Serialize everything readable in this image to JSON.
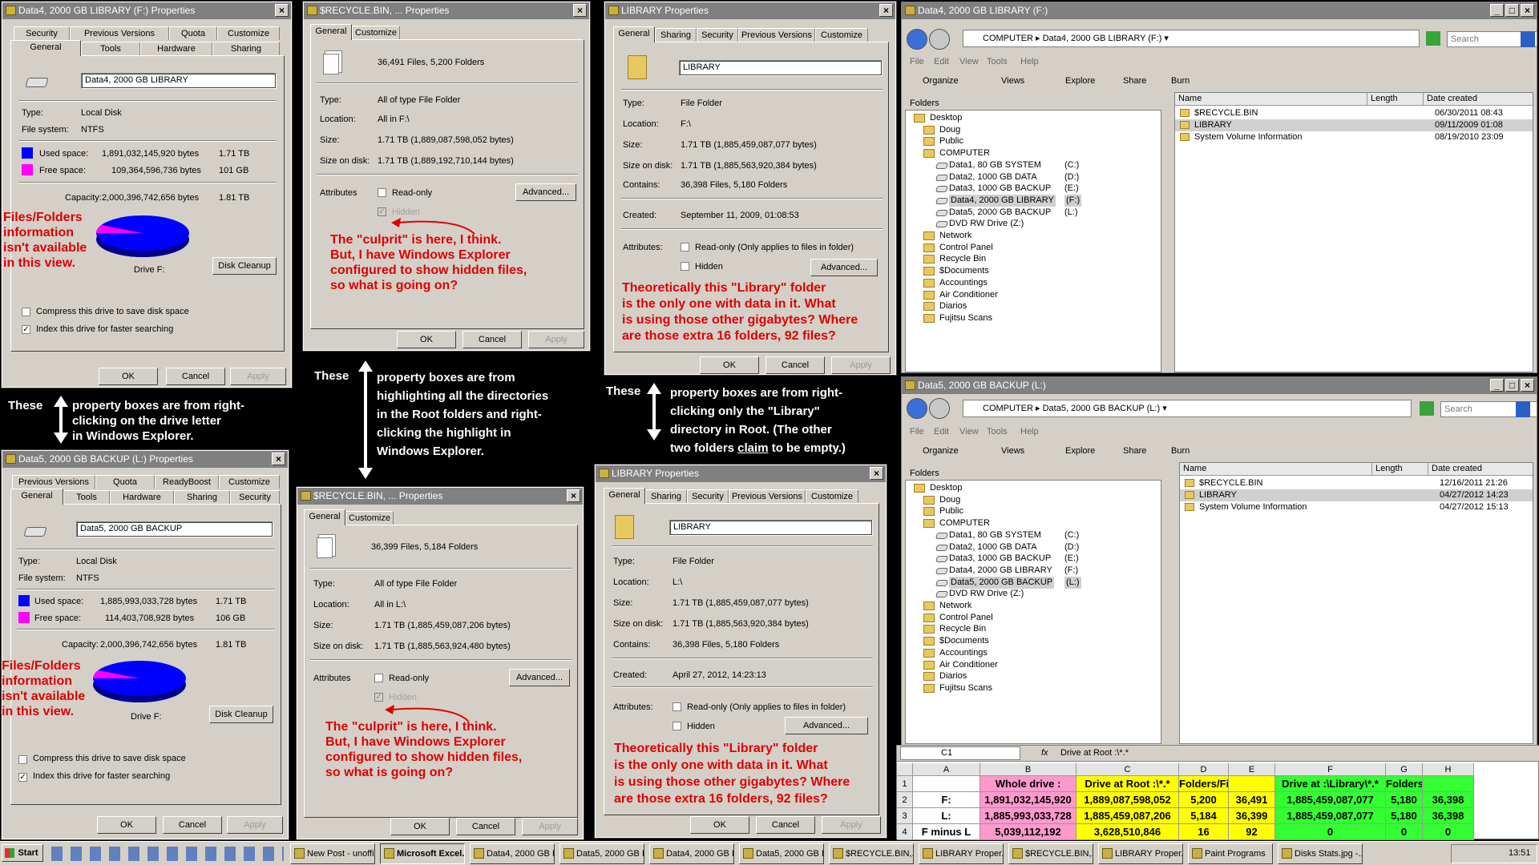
{
  "dlg_f_drive": {
    "title": "Data4, 2000 GB LIBRARY  (F:) Properties",
    "tabs1": [
      "Security",
      "Previous Versions",
      "Quota",
      "Customize"
    ],
    "tabs2": [
      "General",
      "Tools",
      "Hardware",
      "Sharing"
    ],
    "name": "Data4, 2000 GB LIBRARY",
    "type_lbl": "Type:",
    "type_val": "Local Disk",
    "fs_lbl": "File system:",
    "fs_val": "NTFS",
    "used_lbl": "Used space:",
    "used_bytes": "1,891,032,145,920 bytes",
    "used_size": "1.71 TB",
    "free_lbl": "Free space:",
    "free_bytes": "109,364,596,736 bytes",
    "free_size": "101 GB",
    "cap_lbl": "Capacity:",
    "cap_bytes": "2,000,396,742,656 bytes",
    "cap_size": "1.81 TB",
    "drive_lbl": "Drive F:",
    "cleanup": "Disk Cleanup",
    "compress": "Compress this drive to save disk space",
    "index": "Index this drive for faster searching",
    "ok": "OK",
    "cancel": "Cancel",
    "apply": "Apply",
    "note": [
      "Files/Folders",
      "information",
      "isn't available",
      "in this view."
    ]
  },
  "dlg_l_drive": {
    "title": "Data5, 2000 GB BACKUP  (L:) Properties",
    "tabs1": [
      "Previous Versions",
      "Quota",
      "ReadyBoost",
      "Customize"
    ],
    "tabs2": [
      "General",
      "Tools",
      "Hardware",
      "Sharing",
      "Security"
    ],
    "name": "Data5, 2000 GB BACKUP",
    "type_lbl": "Type:",
    "type_val": "Local Disk",
    "fs_lbl": "File system:",
    "fs_val": "NTFS",
    "used_lbl": "Used space:",
    "used_bytes": "1,885,993,033,728 bytes",
    "used_size": "1.71 TB",
    "free_lbl": "Free space:",
    "free_bytes": "114,403,708,928 bytes",
    "free_size": "106 GB",
    "cap_lbl": "Capacity:",
    "cap_bytes": "2,000,396,742,656 bytes",
    "cap_size": "1.81 TB",
    "drive_lbl": "Drive F:",
    "cleanup": "Disk Cleanup",
    "compress": "Compress this drive to save disk space",
    "index": "Index this drive for faster searching",
    "ok": "OK",
    "cancel": "Cancel",
    "apply": "Apply",
    "note": [
      "Files/Folders",
      "information",
      "isn't available",
      "in this view."
    ]
  },
  "dlg_f_root": {
    "title": "$RECYCLE.BIN, ... Properties",
    "tabs": [
      "General",
      "Customize"
    ],
    "count": "36,491 Files, 5,200 Folders",
    "type_lbl": "Type:",
    "type_val": "All of type File Folder",
    "loc_lbl": "Location:",
    "loc_val": "All in F:\\",
    "size_lbl": "Size:",
    "size_val": "1.71 TB (1,889,087,598,052 bytes)",
    "sod_lbl": "Size on disk:",
    "sod_val": "1.71 TB (1,889,192,710,144 bytes)",
    "attr_lbl": "Attributes",
    "ro": "Read-only",
    "hidden": "Hidden",
    "advanced": "Advanced...",
    "ok": "OK",
    "cancel": "Cancel",
    "apply": "Apply",
    "note": [
      "The \"culprit\" is here, I think.",
      "But, I have Windows Explorer",
      "configured to show hidden files,",
      "so what is going on?"
    ]
  },
  "dlg_l_root": {
    "title": "$RECYCLE.BIN, ... Properties",
    "tabs": [
      "General",
      "Customize"
    ],
    "count": "36,399 Files, 5,184 Folders",
    "type_lbl": "Type:",
    "type_val": "All of type File Folder",
    "loc_lbl": "Location:",
    "loc_val": "All in L:\\",
    "size_lbl": "Size:",
    "size_val": "1.71 TB (1,885,459,087,206 bytes)",
    "sod_lbl": "Size on disk:",
    "sod_val": "1.71 TB (1,885,563,924,480 bytes)",
    "attr_lbl": "Attributes",
    "ro": "Read-only",
    "hidden": "Hidden",
    "advanced": "Advanced...",
    "ok": "OK",
    "cancel": "Cancel",
    "apply": "Apply",
    "note": [
      "The \"culprit\" is here, I think.",
      "But, I have Windows Explorer",
      "configured to show hidden files,",
      "so what is going on?"
    ]
  },
  "dlg_f_lib": {
    "title": "LIBRARY Properties",
    "tabs": [
      "General",
      "Sharing",
      "Security",
      "Previous Versions",
      "Customize"
    ],
    "name": "LIBRARY",
    "type_lbl": "Type:",
    "type_val": "File Folder",
    "loc_lbl": "Location:",
    "loc_val": "F:\\",
    "size_lbl": "Size:",
    "size_val": "1.71 TB (1,885,459,087,077 bytes)",
    "sod_lbl": "Size on disk:",
    "sod_val": "1.71 TB (1,885,563,920,384 bytes)",
    "cont_lbl": "Contains:",
    "cont_val": "36,398 Files, 5,180 Folders",
    "created_lbl": "Created:",
    "created_val": "September 11, 2009, 01:08:53",
    "attr_lbl": "Attributes:",
    "ro": "Read-only (Only applies to files in folder)",
    "hidden": "Hidden",
    "advanced": "Advanced...",
    "ok": "OK",
    "cancel": "Cancel",
    "apply": "Apply",
    "note": [
      "Theoretically this \"Library\" folder",
      "is the only one with data in it.  What",
      "is using those other gigabytes? Where",
      "are those extra 16 folders, 92 files?"
    ]
  },
  "dlg_l_lib": {
    "title": "LIBRARY Properties",
    "tabs": [
      "General",
      "Sharing",
      "Security",
      "Previous Versions",
      "Customize"
    ],
    "name": "LIBRARY",
    "type_lbl": "Type:",
    "type_val": "File Folder",
    "loc_lbl": "Location:",
    "loc_val": "L:\\",
    "size_lbl": "Size:",
    "size_val": "1.71 TB (1,885,459,087,077 bytes)",
    "sod_lbl": "Size on disk:",
    "sod_val": "1.71 TB (1,885,563,920,384 bytes)",
    "cont_lbl": "Contains:",
    "cont_val": "36,398 Files, 5,180 Folders",
    "created_lbl": "Created:",
    "created_val": "April 27, 2012, 14:23:13",
    "attr_lbl": "Attributes:",
    "ro": "Read-only (Only applies to files in folder)",
    "hidden": "Hidden",
    "advanced": "Advanced...",
    "ok": "OK",
    "cancel": "Cancel",
    "apply": "Apply",
    "note": [
      "Theoretically this \"Library\" folder",
      "is the only one with data in it.  What",
      "is using those other gigabytes? Where",
      "are those extra 16 folders, 92 files?"
    ]
  },
  "notes": {
    "n1a": "These",
    "n1b": [
      "property boxes are from right-",
      "clicking on the drive letter",
      "in Windows Explorer."
    ],
    "n2a": "These",
    "n2b": [
      "property boxes are from",
      "highlighting all the directories",
      "in the Root folders and right-",
      "clicking the highlight in",
      "Windows Explorer."
    ],
    "n3a": "These",
    "n3b": [
      "property boxes are from right-",
      "clicking only the \"Library\"",
      "directory in Root.  (The other"
    ],
    "n3c": "two folders ",
    "n3d": "claim",
    "n3e": " to be empty.)"
  },
  "exp_f": {
    "title": "Data4, 2000 GB LIBRARY  (F:)",
    "addr1": "COMPUTER",
    "addr2": "Data4, 2000 GB LIBRARY  (F:)",
    "search": "Search",
    "menu": [
      "File",
      "Edit",
      "View",
      "Tools",
      "Help"
    ],
    "toolbar": [
      "Organize",
      "Views",
      "Explore",
      "Share",
      "Burn"
    ],
    "folders": "Folders",
    "cols": [
      "Name",
      "Length",
      "Date created"
    ],
    "files": [
      {
        "n": "$RECYCLE.BIN",
        "d": "06/30/2011 08:43"
      },
      {
        "n": "LIBRARY",
        "d": "09/11/2009 01:08"
      },
      {
        "n": "System Volume Information",
        "d": "08/19/2010 23:09"
      }
    ],
    "tree": [
      {
        "t": "Desktop",
        "l": 0
      },
      {
        "t": "Doug",
        "l": 1
      },
      {
        "t": "Public",
        "l": 1
      },
      {
        "t": "COMPUTER",
        "l": 1
      },
      {
        "t": "Data1, 80 GB SYSTEM",
        "d": "(C:)",
        "l": 2
      },
      {
        "t": "Data2, 1000 GB  DATA",
        "d": "(D:)",
        "l": 2
      },
      {
        "t": "Data3, 1000 GB BACKUP",
        "d": "(E:)",
        "l": 2
      },
      {
        "t": "Data4, 2000 GB LIBRARY",
        "d": "(F:)",
        "l": 2,
        "sel": true
      },
      {
        "t": "Data5, 2000 GB BACKUP",
        "d": "(L:)",
        "l": 2
      },
      {
        "t": "DVD RW Drive (Z:)",
        "l": 2
      },
      {
        "t": "Network",
        "l": 1
      },
      {
        "t": "Control Panel",
        "l": 1
      },
      {
        "t": "Recycle Bin",
        "l": 1
      },
      {
        "t": "$Documents",
        "l": 1
      },
      {
        "t": "Accountings",
        "l": 1
      },
      {
        "t": "Air Conditioner",
        "l": 1
      },
      {
        "t": "Diarios",
        "l": 1
      },
      {
        "t": "Fujitsu Scans",
        "l": 1
      }
    ]
  },
  "exp_l": {
    "title": "Data5, 2000 GB BACKUP  (L:)",
    "addr1": "COMPUTER",
    "addr2": "Data5, 2000 GB BACKUP  (L:)",
    "search": "Search",
    "menu": [
      "File",
      "Edit",
      "View",
      "Tools",
      "Help"
    ],
    "toolbar": [
      "Organize",
      "Views",
      "Explore",
      "Share",
      "Burn"
    ],
    "folders": "Folders",
    "cols": [
      "Name",
      "Length",
      "Date created"
    ],
    "files": [
      {
        "n": "$RECYCLE.BIN",
        "d": "12/16/2011 21:26"
      },
      {
        "n": "LIBRARY",
        "d": "04/27/2012 14:23"
      },
      {
        "n": "System Volume Information",
        "d": "04/27/2012 15:13"
      }
    ],
    "tree": [
      {
        "t": "Desktop",
        "l": 0
      },
      {
        "t": "Doug",
        "l": 1
      },
      {
        "t": "Public",
        "l": 1
      },
      {
        "t": "COMPUTER",
        "l": 1
      },
      {
        "t": "Data1, 80 GB SYSTEM",
        "d": "(C:)",
        "l": 2
      },
      {
        "t": "Data2, 1000 GB  DATA",
        "d": "(D:)",
        "l": 2
      },
      {
        "t": "Data3, 1000 GB BACKUP",
        "d": "(E:)",
        "l": 2
      },
      {
        "t": "Data4, 2000 GB LIBRARY",
        "d": "(F:)",
        "l": 2
      },
      {
        "t": "Data5, 2000 GB BACKUP",
        "d": "(L:)",
        "l": 2,
        "sel": true
      },
      {
        "t": "DVD RW Drive (Z:)",
        "l": 2
      },
      {
        "t": "Network",
        "l": 1
      },
      {
        "t": "Control Panel",
        "l": 1
      },
      {
        "t": "Recycle Bin",
        "l": 1
      },
      {
        "t": "$Documents",
        "l": 1
      },
      {
        "t": "Accountings",
        "l": 1
      },
      {
        "t": "Air Conditioner",
        "l": 1
      },
      {
        "t": "Diarios",
        "l": 1
      },
      {
        "t": "Fujitsu Scans",
        "l": 1
      }
    ]
  },
  "excel": {
    "namebox": "C1",
    "fx": "fx",
    "formula": "Drive at Root  :\\*.*",
    "cols": [
      "A",
      "B",
      "C",
      "D",
      "E",
      "F",
      "G",
      "H"
    ],
    "rows": [
      "1",
      "2",
      "3",
      "4"
    ],
    "data": [
      [
        "",
        "Whole drive :",
        "Drive at Root  :\\*.*",
        "Folders/Files",
        "",
        "Drive at  :\\Library\\*.*",
        "Folders/Files",
        ""
      ],
      [
        "F:",
        "1,891,032,145,920",
        "1,889,087,598,052",
        "5,200",
        "36,491",
        "1,885,459,087,077",
        "5,180",
        "36,398"
      ],
      [
        "L:",
        "1,885,993,033,728",
        "1,885,459,087,206",
        "5,184",
        "36,399",
        "1,885,459,087,077",
        "5,180",
        "36,398"
      ],
      [
        "F minus L",
        "5,039,112,192",
        "3,628,510,846",
        "16",
        "92",
        "0",
        "0",
        "0"
      ]
    ],
    "colors": {
      "pink": "#ff99cc",
      "yellow": "#ffff00",
      "green": "#33ff33"
    }
  },
  "taskbar": {
    "start": "Start",
    "items": [
      "New Post - unoffici...",
      "Microsoft Excel...",
      "Data4, 2000 GB LI...",
      "Data5, 2000 GB B...",
      "Data4, 2000 GB LI...",
      "Data5, 2000 GB B...",
      "$RECYCLE.BIN,...",
      "LIBRARY Proper...",
      "$RECYCLE.BIN,...",
      "LIBRARY Proper...",
      "Paint Programs",
      "Disks Stats.jpg -..."
    ],
    "clock": "13:51"
  },
  "colors": {
    "used": "#0000ff",
    "free": "#ff00ff",
    "note": "#e00000"
  }
}
